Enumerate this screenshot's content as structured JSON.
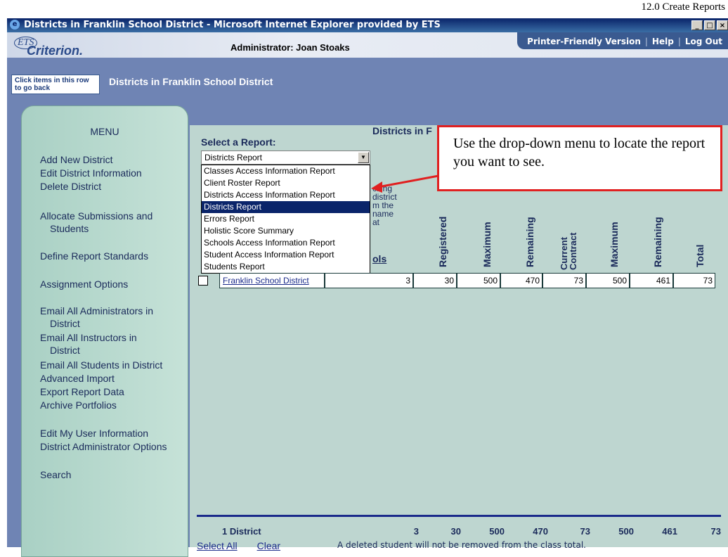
{
  "doc_header": "12.0 Create Reports",
  "window": {
    "title": "Districts in Franklin School District - Microsoft Internet Explorer provided by ETS",
    "buttons": [
      "_",
      "□",
      "×"
    ]
  },
  "header": {
    "logo_ets": "ETS",
    "logo_name": "Criterion.",
    "admin_label": "Administrator: Joan Stoaks",
    "links": [
      "Printer-Friendly Version",
      "Help",
      "Log Out"
    ],
    "link_sep": "|"
  },
  "breadcrumb": {
    "back_button": "Click items in this row to go back",
    "current": "Districts in Franklin School District"
  },
  "menu": {
    "title": "MENU",
    "items": [
      "Add New District",
      "Edit District Information",
      "Delete District",
      "Allocate Submissions and",
      "Students",
      "Define Report Standards",
      "Assignment Options",
      "Email All Administrators in",
      "District",
      "Email All Instructors in",
      "District",
      "Email All Students in District",
      "Advanced Import",
      "Export Report Data",
      "Archive Portfolios",
      "Edit My User Information",
      "District Administrator Options",
      "Search"
    ]
  },
  "report": {
    "content_title": "Districts in F",
    "select_label": "Select a Report:",
    "selected": "Districts Report",
    "options": [
      "Classes Access Information Report",
      "Client Roster Report",
      "Districts Access Information Report",
      "Districts Report",
      "Errors Report",
      "Holistic Score Summary",
      "Schools Access Information Report",
      "Student Access Information Report",
      "Students Report"
    ],
    "partial_text": [
      "cking",
      "district",
      "m the",
      "name",
      "at"
    ],
    "schools_link": "ols"
  },
  "table": {
    "columns": [
      "Registered",
      "Maximum",
      "Remaining",
      "Current Contract",
      "Maximum",
      "Remaining",
      "Total"
    ],
    "row": {
      "name": "Franklin School District",
      "values": [
        "3",
        "30",
        "500",
        "470",
        "73",
        "500",
        "461",
        "73"
      ]
    },
    "totals": {
      "label": "1 District",
      "values": [
        "3",
        "30",
        "500",
        "470",
        "73",
        "500",
        "461",
        "73"
      ]
    }
  },
  "footer": {
    "select_all": "Select All",
    "clear": "Clear",
    "note": "A deleted student will not be removed from the class total."
  },
  "callout": {
    "text": "Use the drop-down menu to locate the report you want to see."
  },
  "colors": {
    "title_bar": "#0a246a",
    "blue_band": "#6f84b4",
    "menu_green": "#a9d0c4",
    "content_bg": "#bed6d0",
    "callout_border": "#e02020"
  }
}
